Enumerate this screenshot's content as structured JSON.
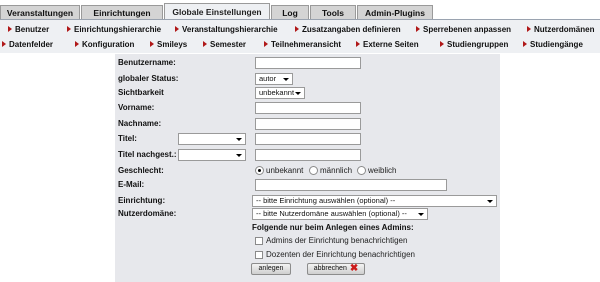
{
  "tabs": [
    {
      "label": "Veranstaltungen"
    },
    {
      "label": "Einrichtungen"
    },
    {
      "label": "Globale Einstellungen"
    },
    {
      "label": "Log"
    },
    {
      "label": "Tools"
    },
    {
      "label": "Admin-Plugins"
    }
  ],
  "subnav": {
    "row1": [
      {
        "label": "Benutzer"
      },
      {
        "label": "Einrichtungshierarchie"
      },
      {
        "label": "Veranstaltungshierarchie"
      },
      {
        "label": "Zusatzangaben definieren"
      },
      {
        "label": "Sperrebenen anpassen"
      },
      {
        "label": "Nutzerdomänen"
      }
    ],
    "row2": [
      {
        "label": "Datenfelder"
      },
      {
        "label": "Konfiguration"
      },
      {
        "label": "Smileys"
      },
      {
        "label": "Semester"
      },
      {
        "label": "Teilnehmeransicht"
      },
      {
        "label": "Externe Seiten"
      },
      {
        "label": "Studiengruppen"
      },
      {
        "label": "Studiengänge"
      }
    ]
  },
  "form": {
    "username_label": "Benutzername:",
    "global_status_label": "globaler Status:",
    "global_status_value": "autor",
    "visibility_label": "Sichtbarkeit",
    "visibility_value": "unbekannt",
    "firstname_label": "Vorname:",
    "lastname_label": "Nachname:",
    "title_label": "Titel:",
    "title_after_label": "Titel nachgest.:",
    "gender_label": "Geschlecht:",
    "gender_options": [
      "unbekannt",
      "männlich",
      "weiblich"
    ],
    "email_label": "E-Mail:",
    "institute_label": "Einrichtung:",
    "institute_placeholder": "-- bitte Einrichtung auswählen (optional) --",
    "domain_label": "Nutzerdomäne:",
    "domain_placeholder": "-- bitte Nutzerdomäne auswählen (optional) --",
    "admin_note": "Folgende nur beim Anlegen eines Admins:",
    "notify_admins": "Admins der Einrichtung benachrichtigen",
    "notify_lecturers": "Dozenten der Einrichtung benachrichtigen",
    "create_button": "anlegen",
    "cancel_button": "abbrechen"
  },
  "colors": {
    "active_tab_bg": "#eef0f3",
    "tab_bg": "#d4d4d4",
    "form_bg": "#e7e8ec",
    "nav_arrow": "#b01818",
    "cancel_x": "#cc1a1a"
  }
}
